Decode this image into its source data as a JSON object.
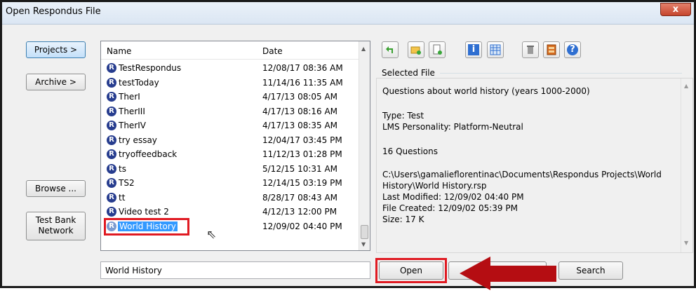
{
  "window": {
    "title": "Open Respondus File",
    "close_glyph": "x"
  },
  "left_buttons": {
    "projects": "Projects >",
    "archive": "Archive >",
    "browse": "Browse ...",
    "test_bank": "Test Bank\nNetwork"
  },
  "file_list": {
    "col_name": "Name",
    "col_date": "Date",
    "rows": [
      {
        "name": "TestRespondus",
        "date": "12/08/17 08:36 AM"
      },
      {
        "name": "testToday",
        "date": "11/14/16 11:35 AM"
      },
      {
        "name": "TherI",
        "date": "4/17/13 08:05 AM"
      },
      {
        "name": "TherIII",
        "date": "4/17/13 08:16 AM"
      },
      {
        "name": "TherIV",
        "date": "4/17/13 08:35 AM"
      },
      {
        "name": "try essay",
        "date": "12/04/17 03:45 PM"
      },
      {
        "name": "tryoffeedback",
        "date": "11/12/13 01:28 PM"
      },
      {
        "name": "ts",
        "date": "5/12/15 10:31 AM"
      },
      {
        "name": "TS2",
        "date": "12/14/15 03:19 PM"
      },
      {
        "name": "tt",
        "date": "8/28/17 08:43 AM"
      },
      {
        "name": "Video test 2",
        "date": "4/12/13 12:00 PM"
      },
      {
        "name": "World History",
        "date": "12/09/02 04:40 PM"
      }
    ],
    "selected_index": 11,
    "icon_letter": "R"
  },
  "name_field": {
    "value": "World History"
  },
  "toolbar": {
    "icons": [
      "back-arrow-icon",
      "new-folder-icon",
      "new-file-icon",
      "info-icon",
      "grid-icon",
      "trash-icon",
      "archive-icon",
      "help-icon"
    ],
    "info_glyph": "i",
    "help_glyph": "?"
  },
  "selected_file": {
    "label": "Selected File",
    "description": "Questions about world history (years 1000-2000)",
    "type": "Type: Test",
    "lms": "LMS Personality: Platform-Neutral",
    "questions": "16 Questions",
    "path_line1": "C:\\Users\\gamalieflorentinac\\Documents\\Respondus Projects\\World",
    "path_line2": "History\\World History.rsp",
    "modified": "Last Modified: 12/09/02  04:40 PM",
    "created": "File Created: 12/09/02  05:39 PM",
    "size": "Size: 17 K"
  },
  "bottom_buttons": {
    "open": "Open",
    "search": "Search"
  },
  "colors": {
    "highlight_red": "#e01a22",
    "arrow_red": "#b50d12",
    "selection_blue": "#3399ff"
  }
}
